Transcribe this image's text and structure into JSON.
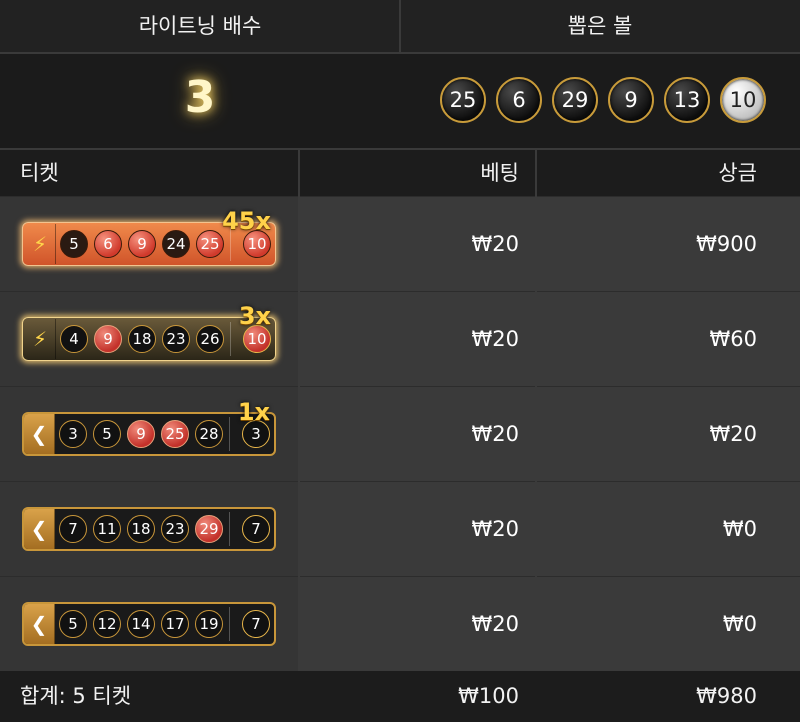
{
  "header": {
    "multiplier_label": "라이트닝 배수",
    "drawn_label": "뽑은 볼",
    "multiplier_value": "3",
    "drawn_balls": [
      {
        "n": "25",
        "style": "black"
      },
      {
        "n": "6",
        "style": "black"
      },
      {
        "n": "29",
        "style": "black"
      },
      {
        "n": "9",
        "style": "black"
      },
      {
        "n": "13",
        "style": "black"
      },
      {
        "n": "10",
        "style": "white"
      }
    ]
  },
  "table": {
    "col_ticket": "티켓",
    "col_bet": "베팅",
    "col_prize": "상금",
    "rows": [
      {
        "type": "lightning",
        "multiplier": "45x",
        "balls": [
          "5",
          "6",
          "9",
          "24",
          "25"
        ],
        "hits": [
          "6",
          "9",
          "25"
        ],
        "bonus": "10",
        "bonus_hit": true,
        "bet": "₩20",
        "prize": "₩900"
      },
      {
        "type": "lightning2",
        "multiplier": "3x",
        "balls": [
          "4",
          "9",
          "18",
          "23",
          "26"
        ],
        "hits": [
          "9"
        ],
        "bonus": "10",
        "bonus_hit": true,
        "bet": "₩20",
        "prize": "₩60"
      },
      {
        "type": "normal",
        "multiplier": "1x",
        "balls": [
          "3",
          "5",
          "9",
          "25",
          "28"
        ],
        "hits": [
          "9",
          "25"
        ],
        "bonus": "3",
        "bonus_hit": false,
        "bet": "₩20",
        "prize": "₩20"
      },
      {
        "type": "normal",
        "multiplier": "",
        "balls": [
          "7",
          "11",
          "18",
          "23",
          "29"
        ],
        "hits": [
          "29"
        ],
        "bonus": "7",
        "bonus_hit": false,
        "bet": "₩20",
        "prize": "₩0"
      },
      {
        "type": "normal",
        "multiplier": "",
        "balls": [
          "5",
          "12",
          "14",
          "17",
          "19"
        ],
        "hits": [],
        "bonus": "7",
        "bonus_hit": false,
        "bet": "₩20",
        "prize": "₩0"
      }
    ],
    "footer": {
      "total_label": "합계: 5 티켓",
      "total_bet": "₩100",
      "total_prize": "₩980"
    }
  },
  "icons": {
    "lightning": "lightning-bolt-icon",
    "normal": "leaf-icon"
  },
  "colors": {
    "hit": "#c3312a",
    "gold": "#c8963a"
  }
}
